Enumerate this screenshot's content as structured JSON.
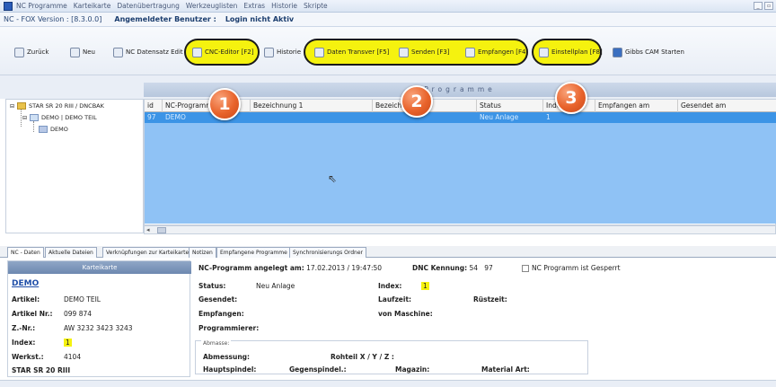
{
  "menubar": {
    "items": [
      "NC Programme",
      "Karteikarte",
      "Datenübertragung",
      "Werkzeuglisten",
      "Extras",
      "Historie",
      "Skripte"
    ]
  },
  "infobar": {
    "version": "NC - FOX Version : [8.3.0.0]",
    "user_label": "Angemeldeter Benutzer :",
    "login_status": "Login nicht Aktiv"
  },
  "toolbar": {
    "back": "Zurück",
    "new": "Neu",
    "record_edit": "NC Datensatz Edit",
    "cnc_editor": "CNC-Editor [F2]",
    "history": "Historie",
    "transfer": "Daten Transver [F5]",
    "send": "Senden [F3]",
    "receive": "Empfangen [F4]",
    "setup_plan": "Einstellplan [F8]",
    "gibbs": "Gibbs CAM Starten"
  },
  "programs_title": "Programme",
  "tree": {
    "root": "STAR SR 20 RIII / DNCBAK",
    "child": "DEMO  |  DEMO TEIL",
    "leaf": "DEMO"
  },
  "grid": {
    "columns": [
      "id",
      "NC-Programm",
      "Bezeichnung 1",
      "Bezeichnung 2",
      "Status",
      "Index",
      "Empfangen am",
      "Gesendet am"
    ],
    "row": {
      "id": "97",
      "nc": "DEMO",
      "bez1": "",
      "bez2": "",
      "status": "Neu Anlage",
      "index": "1",
      "empfangen": "",
      "gesendet": ""
    }
  },
  "badges": [
    "1",
    "2",
    "3"
  ],
  "tabs": [
    "NC - Daten",
    "Aktuelle Dateien",
    "Verknüpfungen zur Karteikarte",
    "Notizen",
    "Empfangene Programme",
    "Synchronisierungs Ordner"
  ],
  "karte": {
    "header": "Karteikarte",
    "title": "DEMO",
    "artikel_label": "Artikel:",
    "artikel": "DEMO TEIL",
    "artnr_label": "Artikel Nr.:",
    "artnr": "099 874",
    "znr_label": "Z.-Nr.:",
    "znr": "AW 3232 3423 3243",
    "index_label": "Index:",
    "index": "1",
    "werkst_label": "Werkst.:",
    "werkst": "4104",
    "machine": "STAR SR 20 RIII"
  },
  "details": {
    "created_label": "NC-Programm angelegt am:",
    "created": "17.02.2013 / 19:47:50",
    "dnc_label": "DNC Kennung:",
    "dnc1": "54",
    "dnc2": "97",
    "locked": "NC Programm ist Gesperrt",
    "status_label": "Status:",
    "status": "Neu Anlage",
    "index_label": "Index:",
    "index": "1",
    "ruest_label": "Rüstzeit:",
    "gesendet_label": "Gesendet:",
    "laufzeit_label": "Laufzeit:",
    "empfangen_label": "Empfangen:",
    "vonmaschine_label": "von Maschine:",
    "programmierer_label": "Programmierer:"
  },
  "abmasse": {
    "legend": "Abmasse:",
    "abmessung": "Abmessung:",
    "rohteil": "Rohteil X / Y / Z :",
    "hauptspindel": "Hauptspindel:",
    "gegenspindel": "Gegenspindel.:",
    "magazin": "Magazin:",
    "material": "Material Art:"
  }
}
